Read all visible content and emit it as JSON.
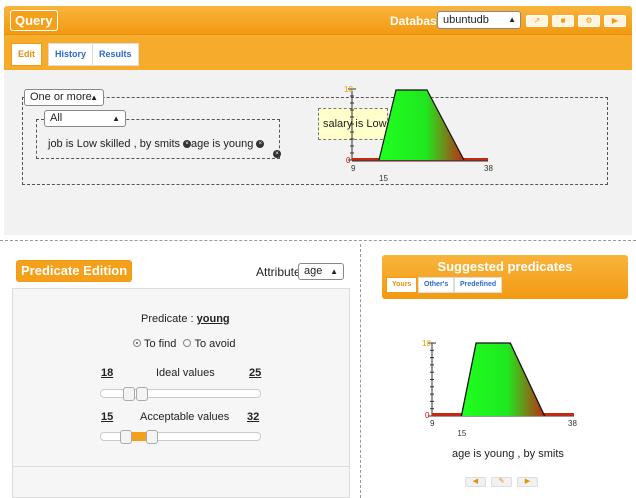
{
  "header": {
    "title": "Query",
    "database_label": "Database",
    "database_value": "ubuntudb",
    "tool_buttons": [
      "↗",
      "■",
      "⚙",
      "▶"
    ]
  },
  "tabs": [
    {
      "label": "Edit",
      "active": true
    },
    {
      "label": "History",
      "active": false
    },
    {
      "label": "Results",
      "active": false
    }
  ],
  "query": {
    "quantifier": "One or more",
    "group_operator": "All",
    "predicate_1": "job is Low skilled , by smits",
    "predicate_2": "age is young",
    "tooltip": "salary is Low"
  },
  "mini_chart": {
    "y_ticks": [
      "10",
      "0"
    ],
    "x_ticks": [
      "9",
      "15",
      "38"
    ]
  },
  "predicate_edition": {
    "title": "Predicate Edition",
    "attribute_label": "Attribute",
    "attribute_value": "age",
    "predicate_label": "Predicate :",
    "predicate_name": "young",
    "radio_find": "To find",
    "radio_avoid": "To avoid",
    "ideal_min": "18",
    "ideal_label": "Ideal values",
    "ideal_max": "25",
    "acceptable_min": "15",
    "acceptable_label": "Acceptable values",
    "acceptable_max": "32"
  },
  "suggested": {
    "title": "Suggested predicates",
    "tabs": [
      {
        "label": "Yours",
        "active": true
      },
      {
        "label": "Other's",
        "active": false
      },
      {
        "label": "Predefined",
        "active": false
      }
    ],
    "caption": "age is young , by smits",
    "buttons": [
      "◀",
      "✎",
      "▶"
    ]
  },
  "chart_data": {
    "type": "area",
    "x": [
      9,
      15,
      18,
      25,
      32,
      38
    ],
    "y": [
      0,
      0,
      10,
      10,
      0,
      0
    ],
    "x_ticks": [
      9,
      15,
      38
    ],
    "y_ticks": [
      0,
      10
    ],
    "xlim": [
      9,
      38
    ],
    "ylim": [
      0,
      10
    ]
  },
  "colors": {
    "accent": "#f29a12",
    "link": "#2b6ad0",
    "fill_green": "#1fff1f",
    "fill_red": "#c22a14"
  }
}
